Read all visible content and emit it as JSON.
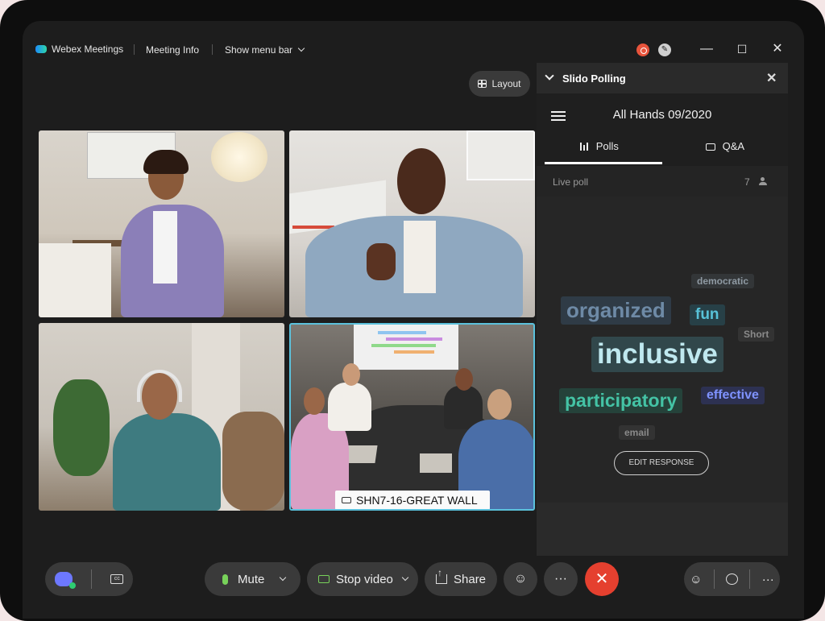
{
  "titlebar": {
    "app_name": "Webex Meetings",
    "meeting_info": "Meeting Info",
    "show_menu_bar": "Show menu bar",
    "minimize": "—",
    "maximize": "☐",
    "close": "✕"
  },
  "layout_button": "Layout",
  "tiles": {
    "room_name": "SHN7-16-GREAT WALL"
  },
  "slido": {
    "title": "Slido Polling",
    "close": "✕",
    "event_name": "All Hands 09/2020",
    "tabs": [
      {
        "label": "Polls",
        "icon": "bar-chart-icon",
        "active": true
      },
      {
        "label": "Q&A",
        "icon": "chat-bubbles-icon",
        "active": false
      }
    ],
    "live_poll_label": "Live poll",
    "participant_count": "7",
    "word_cloud": [
      {
        "text": "democratic",
        "color": "#8f9aa3",
        "bg": "#333638"
      },
      {
        "text": "organized",
        "color": "#6e8aa6",
        "bg": "#2f3b46"
      },
      {
        "text": "fun",
        "color": "#58c2d8",
        "bg": "#274047"
      },
      {
        "text": "Short",
        "color": "#8a8a8a",
        "bg": "#333333"
      },
      {
        "text": "inclusive",
        "color": "#bfe8ef",
        "bg": "#31474b"
      },
      {
        "text": "participatory",
        "color": "#44c3a5",
        "bg": "#25423a"
      },
      {
        "text": "effective",
        "color": "#7f93ff",
        "bg": "#2d3152"
      },
      {
        "text": "email",
        "color": "#8a8a8a",
        "bg": "#333333"
      }
    ],
    "edit_response": "EDIT RESPONSE"
  },
  "controls": {
    "mute": "Mute",
    "stop_video": "Stop video",
    "share": "Share",
    "more": "···",
    "end": "✕"
  },
  "colors": {
    "accent_green": "#78d25a",
    "end_red": "#e5402f",
    "active_tile_border": "#5bc1dc"
  }
}
